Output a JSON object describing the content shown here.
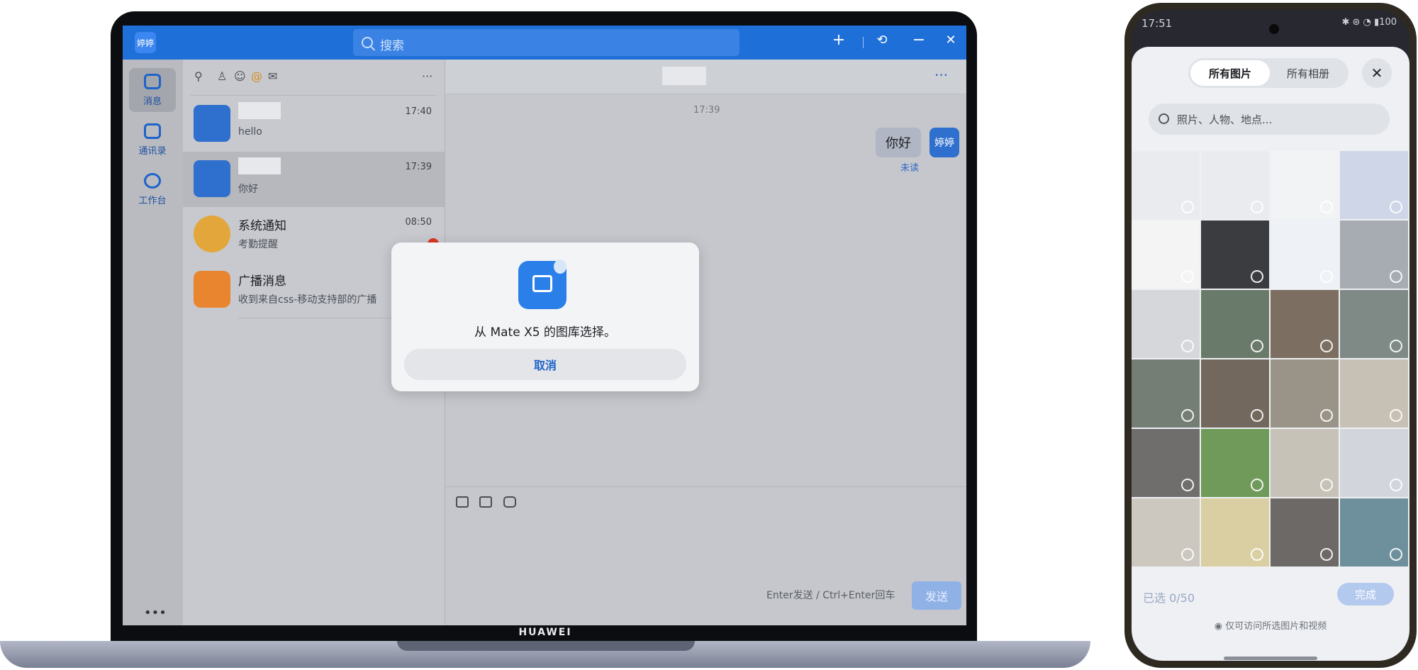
{
  "laptop": {
    "brand": "HUAWEI",
    "titlebar": {
      "avatar_label": "婷婷",
      "search_placeholder": "搜索",
      "add_icon": "+",
      "sync_icon": "⟲",
      "minimize_icon": "−",
      "close_icon": "✕"
    },
    "nav": [
      {
        "label": "消息"
      },
      {
        "label": "通讯录"
      },
      {
        "label": "工作台"
      }
    ],
    "nav_more": "•••",
    "conv_tools_more": "···",
    "conversations": [
      {
        "name": "",
        "time": "17:40",
        "preview": "hello"
      },
      {
        "name": "",
        "time": "17:39",
        "preview": "你好"
      },
      {
        "name": "系统通知",
        "time": "08:50",
        "preview": "考勤提醒"
      },
      {
        "name": "广播消息",
        "time": "",
        "preview": "收到来自css-移动支持部的广播"
      }
    ],
    "chat": {
      "more": "···",
      "msg_time": "17:39",
      "bubble": "你好",
      "me_avatar": "婷婷",
      "read_state": "未读",
      "send_hint": "Enter发送 / Ctrl+Enter回车",
      "send_label": "发送"
    },
    "dialog": {
      "text": "从 Mate X5 的图库选择。",
      "cancel": "取消"
    }
  },
  "phone": {
    "status_time": "17:51",
    "status_right": "✱ ⊛ ◔ ▮100",
    "tabs": {
      "all_photos": "所有图片",
      "all_albums": "所有相册"
    },
    "close": "✕",
    "search_placeholder": "照片、人物、地点...",
    "selected_count": "已选 0/50",
    "done": "完成",
    "permission_note": "仅可访问所选图片和视频",
    "grid_colors": [
      "#e9ebee",
      "#e9ebee",
      "#f2f3f5",
      "#cfd6e8",
      "#f4f4f4",
      "#3a3c40",
      "#eef1f6",
      "#a7abb2",
      "#d5d7da",
      "#6a7a6a",
      "#7c6e60",
      "#7f8a86",
      "#747e74",
      "#72685e",
      "#9a9488",
      "#c7c0b4",
      "#6f6e6c",
      "#6f9a5a",
      "#c7c2b8",
      "#d2d6dc",
      "#ccc8c0",
      "#d9cfa3",
      "#6c6966",
      "#6e8f9c"
    ]
  }
}
